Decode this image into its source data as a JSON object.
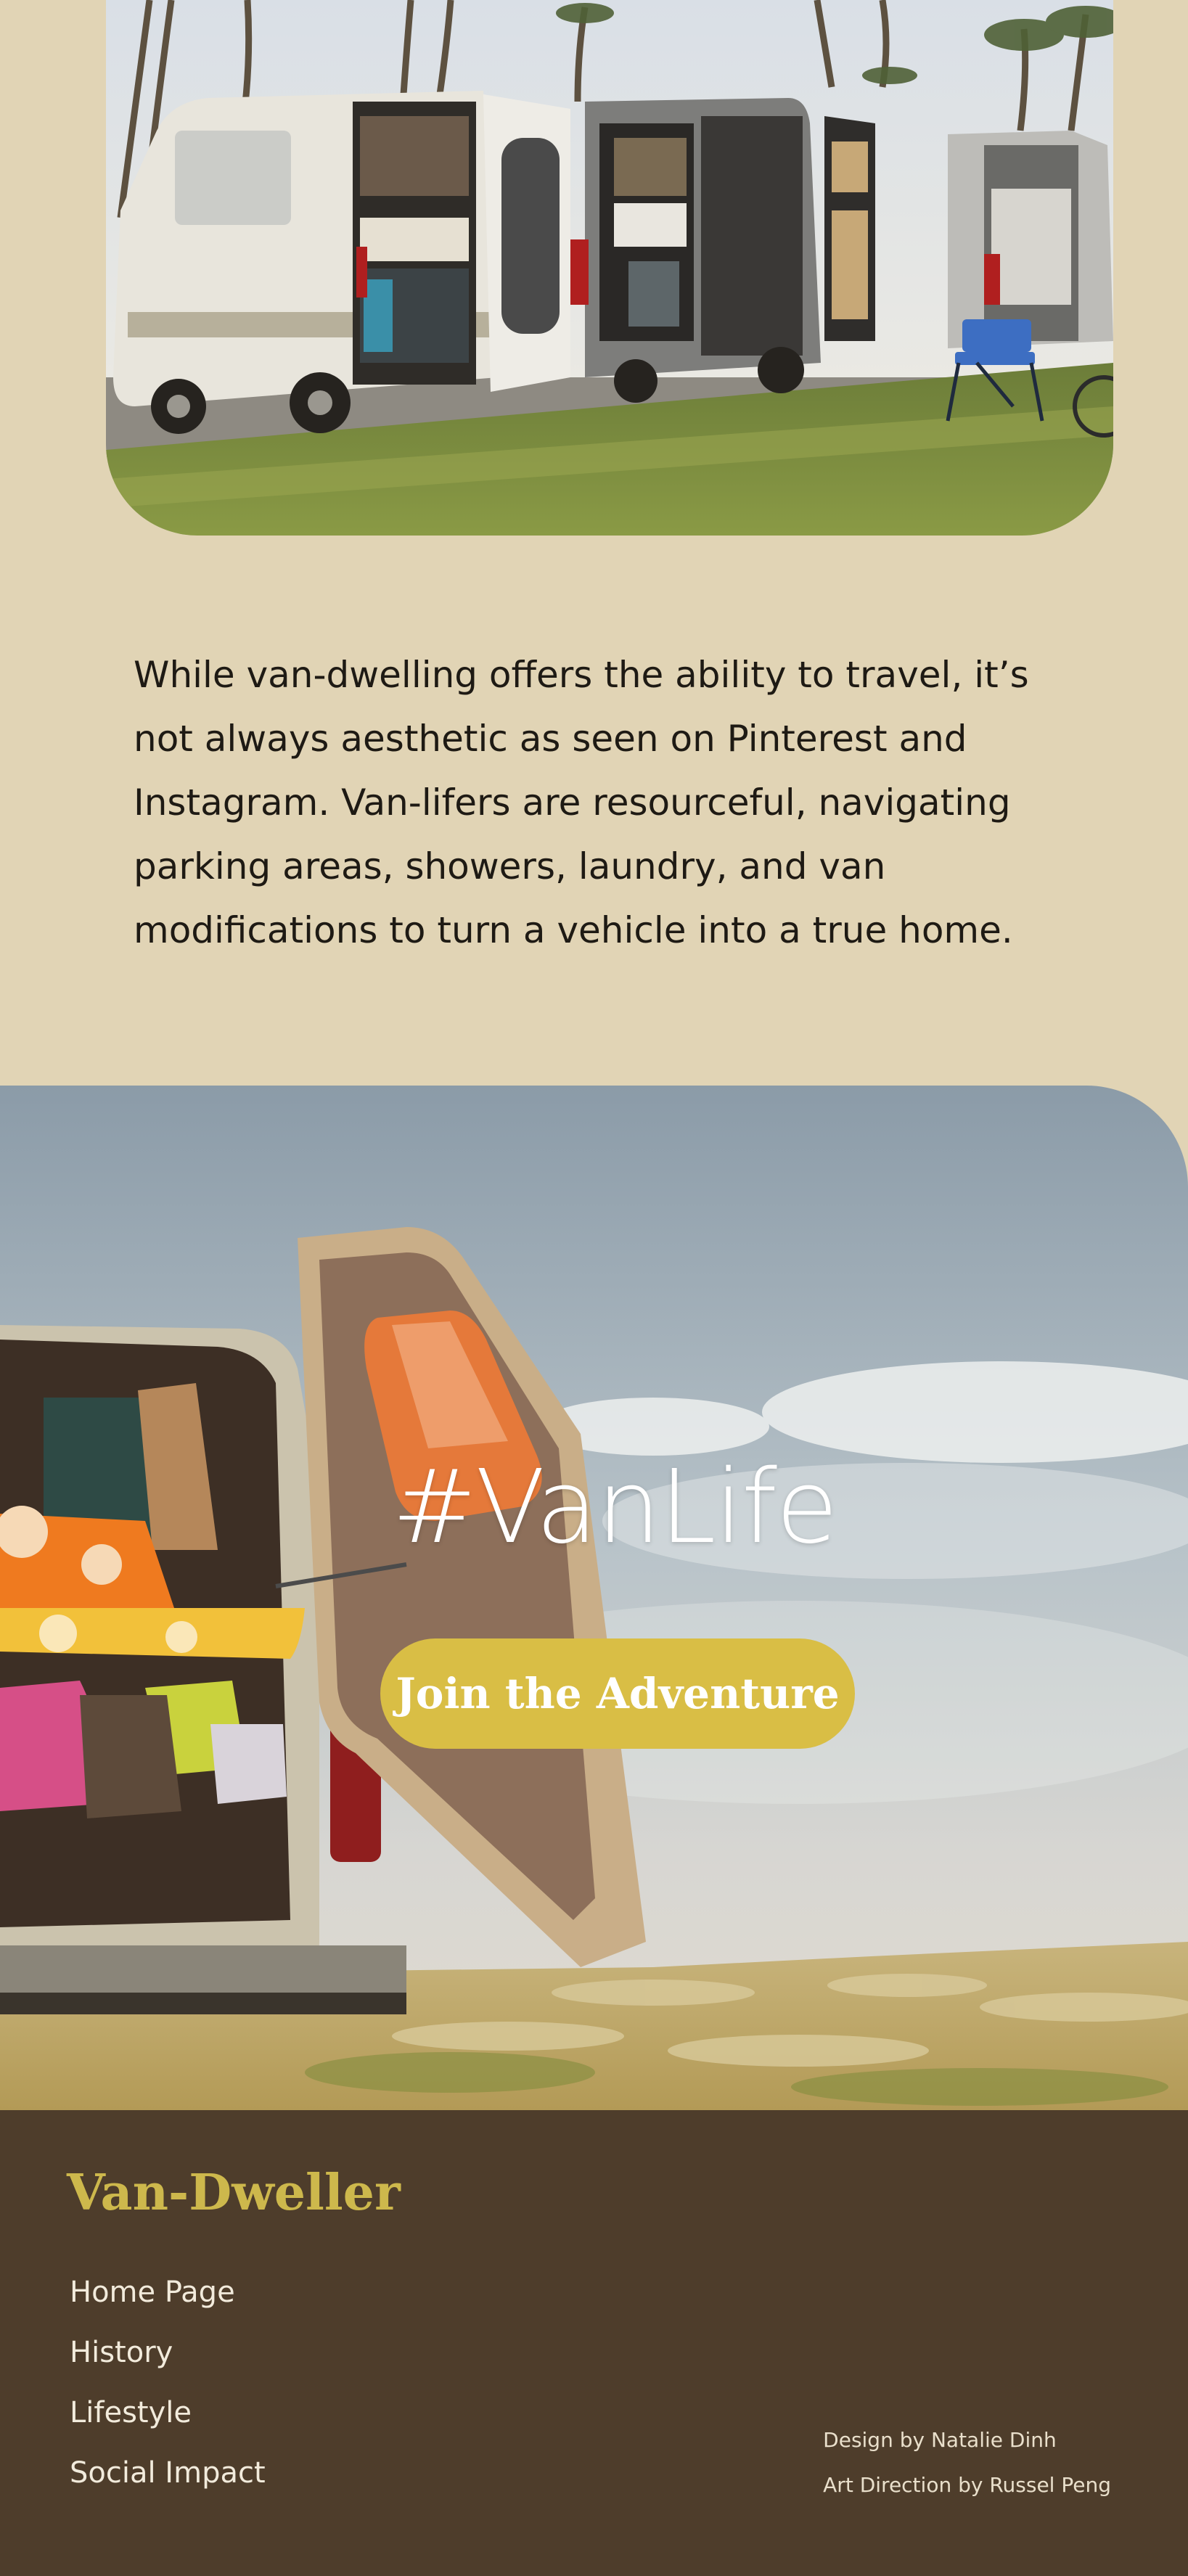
{
  "intro": {
    "text": "While van-dwelling offers the ability to travel, it’s not always aesthetic as seen on Pinterest and Instagram. Van-lifers are resourceful, navigating parking areas, showers, laundry, and van modifications to turn a vehicle into a true home."
  },
  "hero": {
    "title": "#VanLife",
    "cta_label": "Join the Adventure"
  },
  "footer": {
    "brand": "Van-Dweller",
    "nav": [
      "Home Page",
      "History",
      "Lifestyle",
      "Social Impact"
    ],
    "credits": [
      "Design by Natalie Dinh",
      "Art Direction by Russel Peng"
    ]
  },
  "colors": {
    "page_background": "#e1d4b5",
    "footer_background": "#4e3d2b",
    "brand": "#cdb84c",
    "cta": "#d9be45"
  }
}
